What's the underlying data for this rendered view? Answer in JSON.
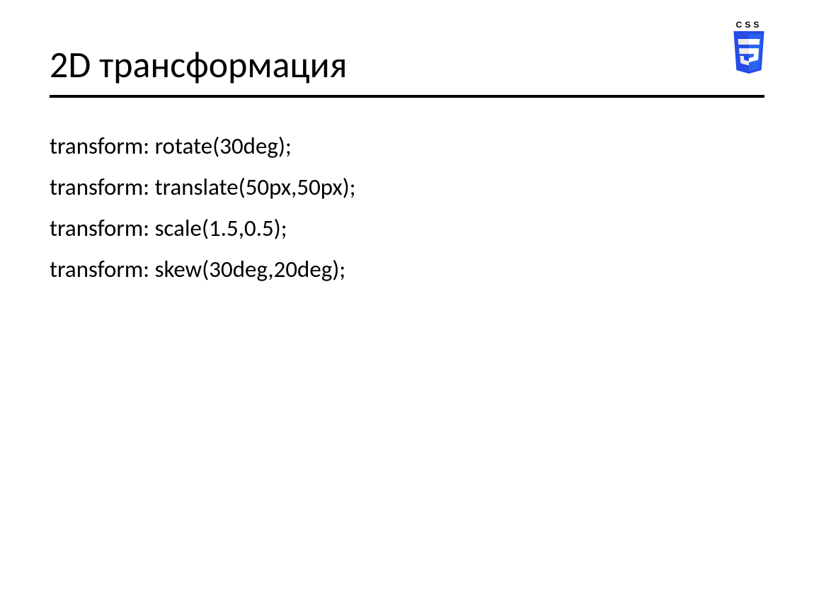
{
  "slide": {
    "title": "2D трансформация",
    "logo_label": "CSS",
    "lines": [
      "transform: rotate(30deg);",
      "transform: translate(50px,50px);",
      "transform: scale(1.5,0.5);",
      "transform: skew(30deg,20deg);"
    ]
  }
}
